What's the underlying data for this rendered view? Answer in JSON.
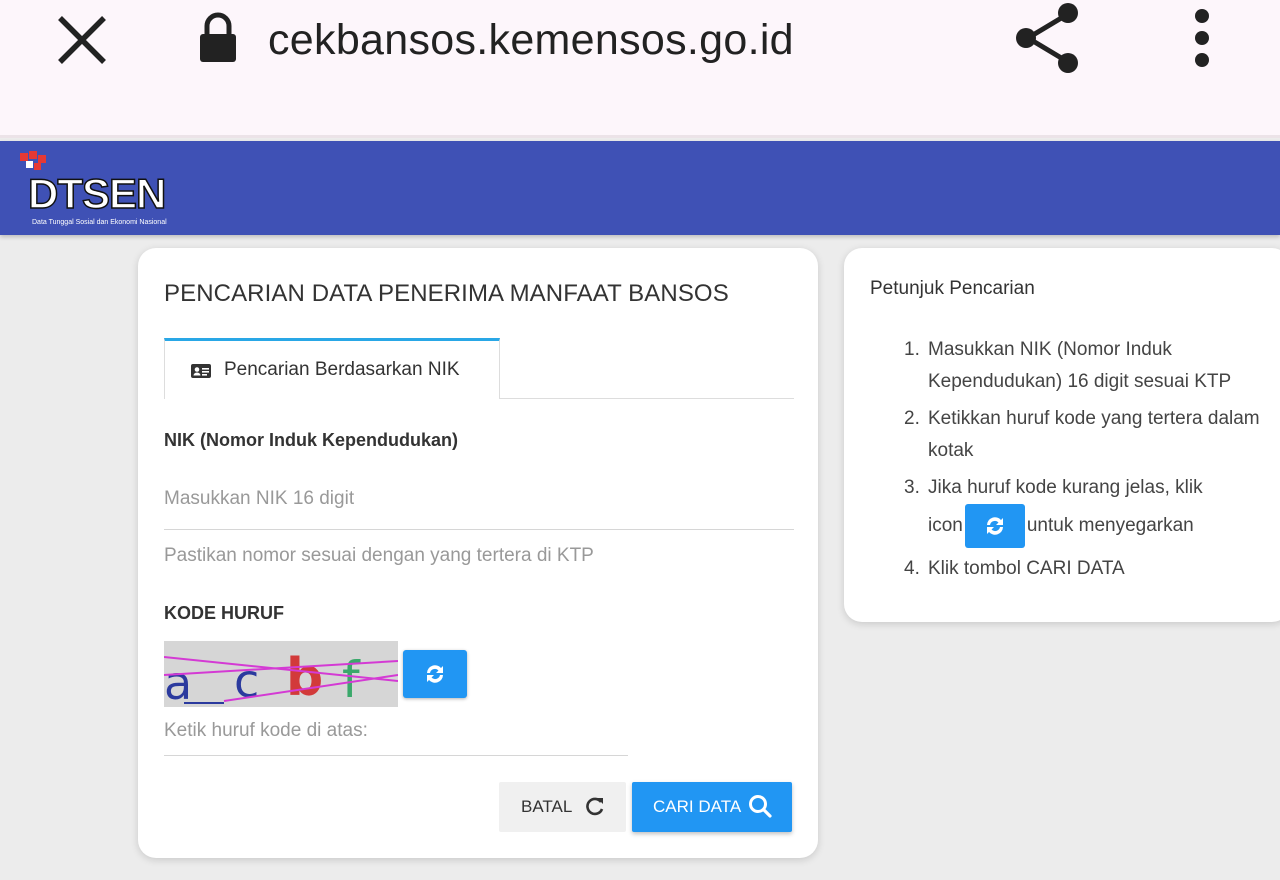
{
  "browser": {
    "url": "cekbansos.kemensos.go.id"
  },
  "header": {
    "logo_text": "DTSEN",
    "logo_tagline": "Data Tunggal Sosial dan Ekonomi Nasional"
  },
  "form": {
    "title": "PENCARIAN DATA PENERIMA MANFAAT BANSOS",
    "tab_label": "Pencarian Berdasarkan NIK",
    "nik_label": "NIK (Nomor Induk Kependudukan)",
    "nik_placeholder": "Masukkan NIK 16 digit",
    "nik_hint": "Pastikan nomor sesuai dengan yang tertera di KTP",
    "captcha_label": "KODE HURUF",
    "captcha_text": "acbf",
    "captcha_placeholder": "Ketik huruf kode di atas:",
    "cancel_label": "BATAL",
    "search_label": "CARI DATA"
  },
  "guide": {
    "title": "Petunjuk Pencarian",
    "steps": [
      "Masukkan NIK (Nomor Induk Kependudukan) 16 digit sesuai KTP",
      "Ketikkan huruf kode yang tertera dalam kotak",
      "Jika huruf kode kurang jelas, klik",
      "untuk menyegarkan",
      "Klik tombol CARI DATA"
    ],
    "step3_icon_prefix": "icon"
  },
  "colors": {
    "header": "#3f51b5",
    "accent": "#2196f3",
    "tab_border": "#29a7e6"
  }
}
